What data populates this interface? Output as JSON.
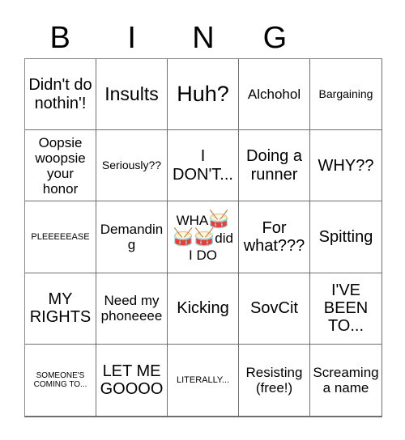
{
  "card": {
    "title_letters": [
      "B",
      "I",
      "N",
      "G",
      ""
    ],
    "columns": 5,
    "rows": 5,
    "border_color": "#6f6f6f",
    "background_color": "#ffffff",
    "text_color": "#000000"
  },
  "cells": [
    {
      "text": "Didn't do nothin'!",
      "size": "l"
    },
    {
      "text": "Insults",
      "size": "xl"
    },
    {
      "text": "Huh?",
      "size": "xxl"
    },
    {
      "text": "Alchohol",
      "size": "m"
    },
    {
      "text": "Bargaining",
      "size": "s"
    },
    {
      "text": "Oopsie woopsie your honor",
      "size": "m"
    },
    {
      "text": "Seriously??",
      "size": "s"
    },
    {
      "text": "I DON'T...",
      "size": "l"
    },
    {
      "text": "Doing a runner",
      "size": "l"
    },
    {
      "text": "WHY??",
      "size": "l"
    },
    {
      "text": "PLEEEEEASE",
      "size": "xs"
    },
    {
      "text": "Demanding",
      "size": "m"
    },
    {
      "text": "WHA🥁🥁🥁did I DO",
      "size": "m",
      "has_emoji": true
    },
    {
      "text": "For what???",
      "size": "l"
    },
    {
      "text": "Spitting",
      "size": "l"
    },
    {
      "text": "MY RIGHTS",
      "size": "l"
    },
    {
      "text": "Need my phoneeee",
      "size": "m"
    },
    {
      "text": "Kicking",
      "size": "l"
    },
    {
      "text": "SovCit",
      "size": "l"
    },
    {
      "text": "I'VE BEEN TO...",
      "size": "l"
    },
    {
      "text": "SOMEONE'S COMING TO...",
      "size": "xxs"
    },
    {
      "text": "LET ME GOOOO",
      "size": "l"
    },
    {
      "text": "LITERALLY...",
      "size": "xs"
    },
    {
      "text": "Resisting (free!)",
      "size": "m"
    },
    {
      "text": "Screaming a name",
      "size": "m"
    }
  ]
}
